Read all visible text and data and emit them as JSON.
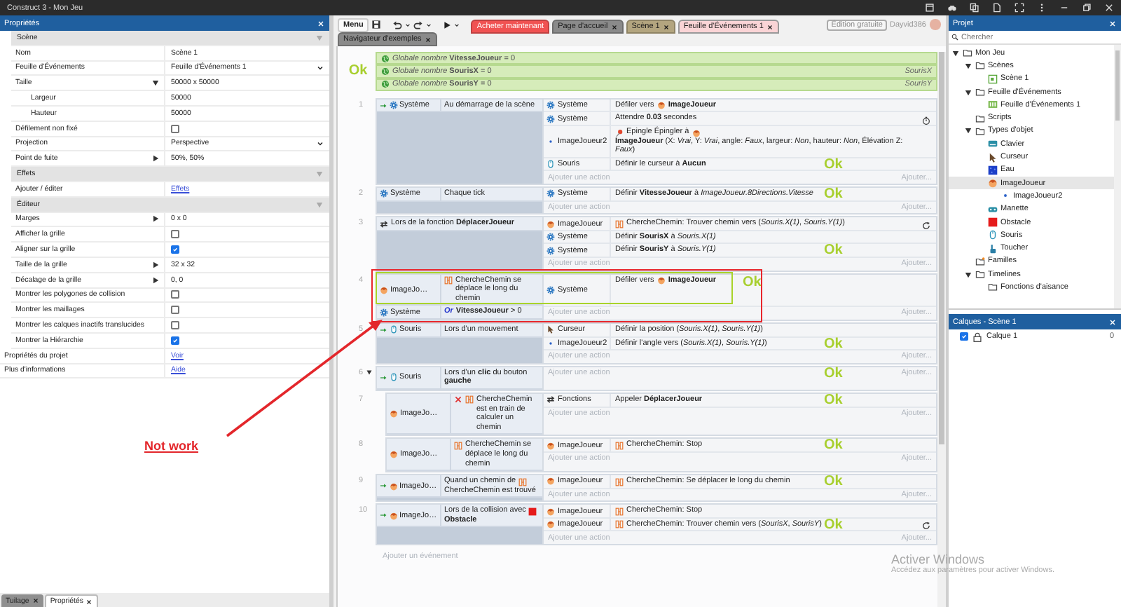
{
  "window": {
    "title": "Construct 3 - Mon Jeu"
  },
  "properties": {
    "title": "Propriétés",
    "rows": [
      {
        "kind": "section",
        "label": "Scène",
        "expanded": true,
        "children": [
          {
            "kind": "text",
            "label": "Nom",
            "value": "Scène 1"
          },
          {
            "kind": "select",
            "label": "Feuille d'Événements",
            "value": "Feuille d'Événements 1"
          },
          {
            "kind": "group",
            "label": "Taille",
            "value": "50000 x 50000",
            "expanded": true,
            "children": [
              {
                "kind": "text",
                "label": "Largeur",
                "value": "50000"
              },
              {
                "kind": "text",
                "label": "Hauteur",
                "value": "50000"
              }
            ]
          },
          {
            "kind": "check",
            "label": "Défilement non fixé",
            "checked": false
          },
          {
            "kind": "select",
            "label": "Projection",
            "value": "Perspective"
          },
          {
            "kind": "group",
            "label": "Point de fuite",
            "value": "50%, 50%",
            "expanded": false
          }
        ]
      },
      {
        "kind": "section",
        "label": "Effets",
        "expanded": true,
        "children": [
          {
            "kind": "link",
            "label": "Ajouter / éditer",
            "value": "Effets"
          }
        ]
      },
      {
        "kind": "section",
        "label": "Éditeur",
        "expanded": true,
        "children": [
          {
            "kind": "group",
            "label": "Marges",
            "value": "0 x 0",
            "expanded": false
          },
          {
            "kind": "check",
            "label": "Afficher la grille",
            "checked": false
          },
          {
            "kind": "check",
            "label": "Aligner sur la grille",
            "checked": true
          },
          {
            "kind": "group",
            "label": "Taille de la grille",
            "value": "32 x 32",
            "expanded": false
          },
          {
            "kind": "group",
            "label": "Décalage de la grille",
            "value": "0, 0",
            "expanded": false
          },
          {
            "kind": "check",
            "label": "Montrer les polygones de collision",
            "checked": false
          },
          {
            "kind": "check",
            "label": "Montrer les maillages",
            "checked": false
          },
          {
            "kind": "check",
            "label": "Montrer les calques inactifs translucides",
            "checked": false
          },
          {
            "kind": "check",
            "label": "Montrer la Hiérarchie",
            "checked": true
          }
        ]
      },
      {
        "kind": "link",
        "label": "Propriétés du projet",
        "value": "Voir"
      },
      {
        "kind": "link",
        "label": "Plus d'informations",
        "value": "Aide"
      }
    ]
  },
  "bottom_tabs": [
    {
      "label": "Tuilage",
      "selected": false
    },
    {
      "label": "Propriétés",
      "selected": true
    }
  ],
  "toolbar": {
    "menu": "Menu",
    "tabs": [
      {
        "label": "Acheter maintenant",
        "kind": "promo",
        "color": "#f05252",
        "selected": false,
        "closable": false
      },
      {
        "label": "Page d'accueil",
        "kind": "document",
        "color": "#8a8a8a",
        "selected": false,
        "closable": true
      },
      {
        "label": "Scène 1",
        "kind": "document",
        "color": "#b3a57f",
        "selected": false,
        "closable": true
      },
      {
        "label": "Feuille d'Événements 1",
        "kind": "document",
        "color": "#fad4d6",
        "selected": true,
        "closable": true
      }
    ],
    "tabs_row2": [
      {
        "label": "Navigateur d'exemples",
        "kind": "document",
        "color": "#8a8a8a",
        "selected": false,
        "closable": true
      }
    ]
  },
  "account": {
    "edition": "Édition gratuite",
    "user": "Dayvid386"
  },
  "event_sheet": {
    "note": "Ok",
    "globals": [
      {
        "text": "*Globale nombre* **VitesseJoueur** = 0"
      },
      {
        "text": "*Globale nombre* **SourisX** = 0",
        "comment": "SourisX"
      },
      {
        "text": "*Globale nombre* **SourisY** = 0",
        "comment": "SourisY"
      }
    ],
    "events": [
      {
        "number": "1",
        "trigger": true,
        "conditions": [
          {
            "object": "Système",
            "kind": "system",
            "inverted": false,
            "parts": [
              {
                "kind": "text",
                "text": "Au démarrage de la scène"
              }
            ]
          }
        ],
        "actions": [
          {
            "object": "Système",
            "kind": "system",
            "parts": [
              {
                "kind": "text",
                "text": "Défiler vers"
              },
              {
                "kind": "sprite"
              },
              {
                "kind": "text",
                "text": "**ImageJoueur**"
              }
            ]
          },
          {
            "object": "Système",
            "kind": "system",
            "parts": [
              {
                "kind": "text",
                "text": "Attendre **0.03** secondes"
              },
              {
                "kind": "timer"
              }
            ]
          },
          {
            "object": "ImageJoueur2",
            "kind": "dot",
            "parts": [
              {
                "kind": "pin"
              },
              {
                "kind": "text",
                "text": "Epingle Épingler à"
              },
              {
                "kind": "sprite"
              },
              {
                "kind": "text",
                "text": "**ImageJoueur** (X: *Vrai*, Y: *Vrai*, angle: *Faux*, largeur: *Non*, hauteur: *Non*, Élévation Z: *Faux*)"
              }
            ]
          },
          {
            "object": "Souris",
            "kind": "mouse",
            "parts": [
              {
                "kind": "text",
                "text": "Définir le curseur à **Aucun**"
              }
            ]
          }
        ],
        "add_action": "Ajouter une action",
        "add_more": "Ajouter...",
        "note": "Ok"
      },
      {
        "number": "2",
        "trigger": false,
        "conditions": [
          {
            "object": "Système",
            "kind": "system",
            "inverted": false,
            "parts": [
              {
                "kind": "text",
                "text": "Chaque tick"
              }
            ]
          }
        ],
        "actions": [
          {
            "object": "Système",
            "kind": "system",
            "parts": [
              {
                "kind": "text",
                "text": "Définir **VitesseJoueur** à *ImageJoueur.8Directions.Vitesse*"
              }
            ]
          }
        ],
        "add_action": "Ajouter une action",
        "add_more": "Ajouter...",
        "note": "Ok"
      },
      {
        "number": "3",
        "trigger": false,
        "conditions": [
          {
            "kind": "function",
            "inverted": false,
            "parts": [
              {
                "kind": "text",
                "text": "Lors de la fonction **DéplacerJoueur**"
              }
            ]
          }
        ],
        "actions": [
          {
            "object": "ImageJoueur",
            "kind": "sprite",
            "parts": [
              {
                "kind": "behavior"
              },
              {
                "kind": "text",
                "text": "ChercheChemin: Trouver chemin vers (*Souris.X(1)*, *Souris.Y(1)*)"
              },
              {
                "kind": "loop"
              }
            ]
          },
          {
            "object": "Système",
            "kind": "system",
            "parts": [
              {
                "kind": "text",
                "text": "Définir **SourisX** à *Souris.X(1)*"
              }
            ]
          },
          {
            "object": "Système",
            "kind": "system",
            "parts": [
              {
                "kind": "text",
                "text": "Définir **SourisY** à *Souris.Y(1)*"
              }
            ]
          }
        ],
        "add_action": "Ajouter une action",
        "add_more": "Ajouter...",
        "note": "Ok"
      },
      {
        "number": "4",
        "trigger": false,
        "boxed": true,
        "conditions": [
          {
            "object": "ImageJo…",
            "kind": "sprite",
            "inverted": false,
            "parts": [
              {
                "kind": "behavior"
              },
              {
                "kind": "text",
                "text": "ChercheChemin se déplace le long du chemin"
              }
            ]
          },
          {
            "object": "Système",
            "kind": "system",
            "inverted": false,
            "parts": [
              {
                "kind": "keyword",
                "text": "Or"
              },
              {
                "kind": "text",
                "text": "**VitesseJoueur** > 0"
              }
            ]
          }
        ],
        "actions": [
          {
            "object": "Système",
            "kind": "system",
            "parts": [
              {
                "kind": "text",
                "text": "Défiler vers"
              },
              {
                "kind": "sprite"
              },
              {
                "kind": "text",
                "text": "**ImageJoueur**"
              }
            ]
          }
        ],
        "add_action": "Ajouter une action",
        "add_more": "Ajouter...",
        "note": "Ok"
      },
      {
        "number": "5",
        "trigger": true,
        "conditions": [
          {
            "object": "Souris",
            "kind": "mouse",
            "inverted": false,
            "parts": [
              {
                "kind": "text",
                "text": "Lors d'un mouvement"
              }
            ]
          }
        ],
        "actions": [
          {
            "object": "Curseur",
            "kind": "cursor",
            "parts": [
              {
                "kind": "text",
                "text": "Définir la position (*Souris.X(1)*, *Souris.Y(1)*)"
              }
            ]
          },
          {
            "object": "ImageJoueur2",
            "kind": "dot",
            "parts": [
              {
                "kind": "text",
                "text": "Définir l'angle vers (*Souris.X(1)*, *Souris.Y(1)*)"
              }
            ]
          }
        ],
        "add_action": "Ajouter une action",
        "add_more": "Ajouter...",
        "note": "Ok"
      },
      {
        "number": "6",
        "trigger": true,
        "expanded": true,
        "conditions": [
          {
            "object": "Souris",
            "kind": "mouse",
            "inverted": false,
            "parts": [
              {
                "kind": "text",
                "text": "Lors d'un **clic** du bouton **gauche**"
              }
            ]
          }
        ],
        "add_action": "Ajouter une action",
        "add_more": "Ajouter...",
        "note": "Ok",
        "children": [
          {
            "number": "7",
            "trigger": false,
            "conditions": [
              {
                "object": "ImageJo…",
                "kind": "sprite",
                "inverted": true,
                "parts": [
                  {
                    "kind": "behavior"
                  },
                  {
                    "kind": "text",
                    "text": "ChercheChemin est en train de calculer un chemin"
                  }
                ]
              }
            ],
            "actions": [
              {
                "object": "Fonctions",
                "kind": "function",
                "parts": [
                  {
                    "kind": "text",
                    "text": "Appeler **DéplacerJoueur**"
                  }
                ]
              }
            ],
            "add_action": "Ajouter une action",
            "add_more": "Ajouter...",
            "note": "Ok"
          },
          {
            "number": "8",
            "trigger": false,
            "conditions": [
              {
                "object": "ImageJo…",
                "kind": "sprite",
                "inverted": false,
                "parts": [
                  {
                    "kind": "behavior"
                  },
                  {
                    "kind": "text",
                    "text": "ChercheChemin se déplace le long du chemin"
                  }
                ]
              }
            ],
            "actions": [
              {
                "object": "ImageJoueur",
                "kind": "sprite",
                "parts": [
                  {
                    "kind": "behavior"
                  },
                  {
                    "kind": "text",
                    "text": "ChercheChemin: Stop"
                  }
                ]
              }
            ],
            "add_action": "Ajouter une action",
            "add_more": "Ajouter...",
            "note": "Ok"
          }
        ]
      },
      {
        "number": "9",
        "trigger": true,
        "conditions": [
          {
            "object": "ImageJo…",
            "kind": "sprite",
            "inverted": false,
            "parts": [
              {
                "kind": "text",
                "text": "Quand un chemin de"
              },
              {
                "kind": "behavior"
              },
              {
                "kind": "text",
                "text": "ChercheChemin est trouvé"
              }
            ]
          }
        ],
        "actions": [
          {
            "object": "ImageJoueur",
            "kind": "sprite",
            "parts": [
              {
                "kind": "behavior"
              },
              {
                "kind": "text",
                "text": "ChercheChemin: Se déplacer le long du chemin"
              }
            ]
          }
        ],
        "add_action": "Ajouter une action",
        "add_more": "Ajouter...",
        "note": "Ok"
      },
      {
        "number": "10",
        "trigger": true,
        "conditions": [
          {
            "object": "ImageJo…",
            "kind": "sprite",
            "inverted": false,
            "parts": [
              {
                "kind": "text",
                "text": "Lors de la collision avec"
              },
              {
                "kind": "swatch"
              },
              {
                "kind": "text",
                "text": "**Obstacle**"
              }
            ]
          }
        ],
        "actions": [
          {
            "object": "ImageJoueur",
            "kind": "sprite",
            "parts": [
              {
                "kind": "behavior"
              },
              {
                "kind": "text",
                "text": "ChercheChemin: Stop"
              }
            ]
          },
          {
            "object": "ImageJoueur",
            "kind": "sprite",
            "parts": [
              {
                "kind": "behavior"
              },
              {
                "kind": "text",
                "text": "ChercheChemin: Trouver chemin vers (*SourisX*, *SourisY*)"
              },
              {
                "kind": "loop"
              }
            ]
          }
        ],
        "add_action": "Ajouter une action",
        "add_more": "Ajouter...",
        "note": "Ok"
      }
    ],
    "add_event": "Ajouter un événement"
  },
  "project": {
    "title": "Projet",
    "search": {
      "placeholder": "Chercher"
    },
    "tree": [
      {
        "label": "Mon Jeu",
        "kind": "folder",
        "expanded": true,
        "selected": false,
        "children": [
          {
            "label": "Scènes",
            "kind": "folder",
            "expanded": true,
            "selected": false,
            "children": [
              {
                "label": "Scène 1",
                "kind": "scene",
                "selected": false
              }
            ]
          },
          {
            "label": "Feuille d'Événements",
            "kind": "folder",
            "expanded": true,
            "selected": false,
            "children": [
              {
                "label": "Feuille d'Événements 1",
                "kind": "sheet",
                "selected": false
              }
            ]
          },
          {
            "label": "Scripts",
            "kind": "folder",
            "selected": false
          },
          {
            "label": "Types d'objet",
            "kind": "folder",
            "expanded": true,
            "selected": false,
            "children": [
              {
                "label": "Clavier",
                "kind": "keyboard",
                "selected": false
              },
              {
                "label": "Curseur",
                "kind": "cursor",
                "selected": false
              },
              {
                "label": "Eau",
                "kind": "water",
                "selected": false
              },
              {
                "label": "ImageJoueur",
                "kind": "sprite",
                "selected": true,
                "children": [
                  {
                    "label": "ImageJoueur2",
                    "kind": "dot",
                    "selected": false
                  }
                ]
              },
              {
                "label": "Manette",
                "kind": "gamepad",
                "selected": false
              },
              {
                "label": "Obstacle",
                "kind": "swatch",
                "selected": false
              },
              {
                "label": "Souris",
                "kind": "mouse",
                "selected": false
              },
              {
                "label": "Toucher",
                "kind": "touch",
                "selected": false
              }
            ]
          },
          {
            "label": "Familles",
            "kind": "families",
            "selected": false
          },
          {
            "label": "Timelines",
            "kind": "folder",
            "expanded": true,
            "selected": false,
            "children": [
              {
                "label": "Fonctions d'aisance",
                "kind": "folder",
                "selected": false
              }
            ]
          }
        ]
      }
    ]
  },
  "layers": {
    "title": "Calques - Scène 1",
    "items": [
      {
        "label": "Calque 1",
        "visible": true,
        "count": "0"
      }
    ]
  },
  "annotation": {
    "text": "Not work"
  },
  "os_notice": {
    "title": "Activer Windows",
    "text": "Accédez aux paramètres pour activer Windows."
  }
}
